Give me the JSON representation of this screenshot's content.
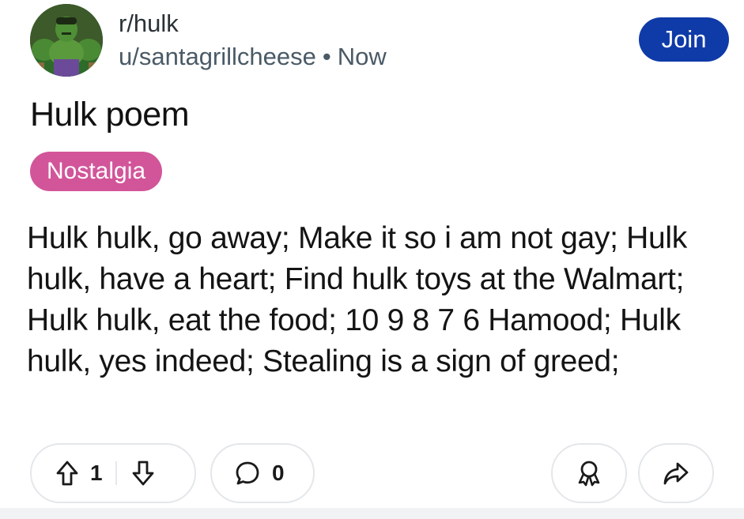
{
  "header": {
    "subreddit": "r/hulk",
    "username": "u/santagrillcheese",
    "separator": "•",
    "time": "Now",
    "join_label": "Join"
  },
  "post": {
    "title": "Hulk poem",
    "flair": "Nostalgia",
    "body": "Hulk hulk, go away; Make it so i am not gay; Hulk hulk, have a heart; Find hulk toys at the Walmart; Hulk hulk, eat the food; 10 9 8 7 6 Hamood; Hulk hulk, yes indeed; Stealing is a sign of greed;"
  },
  "actions": {
    "vote_count": "1",
    "comment_count": "0"
  },
  "colors": {
    "join_button": "#0f3ba8",
    "flair": "#d2559a",
    "pill_border": "#e4e7ea"
  },
  "icons": [
    "subreddit-avatar",
    "upvote-icon",
    "downvote-icon",
    "comment-icon",
    "award-icon",
    "share-icon"
  ]
}
